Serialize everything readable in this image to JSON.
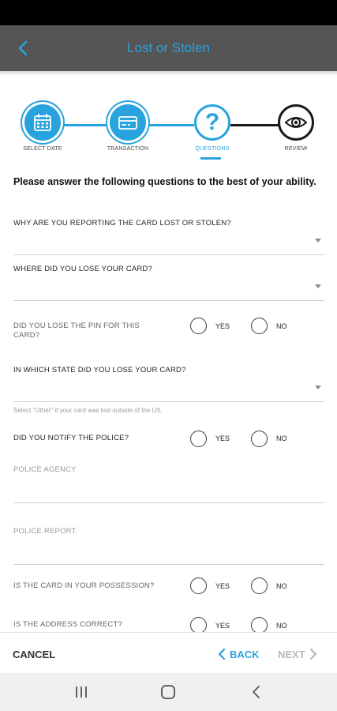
{
  "header": {
    "title": "Lost or Stolen",
    "back_icon": "chevron-left-icon"
  },
  "stepper": {
    "steps": [
      {
        "label": "SELECT DATE",
        "icon": "calendar-icon",
        "state": "done"
      },
      {
        "label": "TRANSACTION",
        "icon": "credit-card-icon",
        "state": "done"
      },
      {
        "label": "QUESTIONS",
        "icon": "question-mark-icon",
        "state": "active"
      },
      {
        "label": "REVIEW",
        "icon": "eye-icon",
        "state": "pending"
      }
    ]
  },
  "intro": "Please answer the following questions to the best of your ability.",
  "questions": {
    "reason": {
      "label": "WHY ARE YOU REPORTING THE CARD LOST OR STOLEN?",
      "value": ""
    },
    "location": {
      "label": "WHERE DID YOU LOSE YOUR CARD?",
      "value": ""
    },
    "lost_pin": {
      "label": "DID YOU LOSE THE PIN FOR THIS CARD?",
      "yes": "YES",
      "no": "NO"
    },
    "state": {
      "label": "IN WHICH STATE DID YOU LOSE YOUR CARD?",
      "hint": "Select \"Other\" if your card was lost outside of the US.",
      "value": ""
    },
    "notify_police": {
      "label": "DID YOU NOTIFY THE POLICE?",
      "yes": "YES",
      "no": "NO"
    },
    "police_agency": {
      "placeholder": "POLICE AGENCY"
    },
    "police_report": {
      "placeholder": "POLICE REPORT"
    },
    "possession": {
      "label": "IS THE CARD IN YOUR POSSESSION?",
      "yes": "YES",
      "no": "NO"
    },
    "address": {
      "label": "IS THE ADDRESS CORRECT?",
      "yes": "YES",
      "no": "NO"
    }
  },
  "footer": {
    "cancel": "CANCEL",
    "back": "BACK",
    "next": "NEXT"
  },
  "colors": {
    "accent": "#29a3dd",
    "header_bg": "#555555",
    "disabled": "#b9b9b9"
  }
}
